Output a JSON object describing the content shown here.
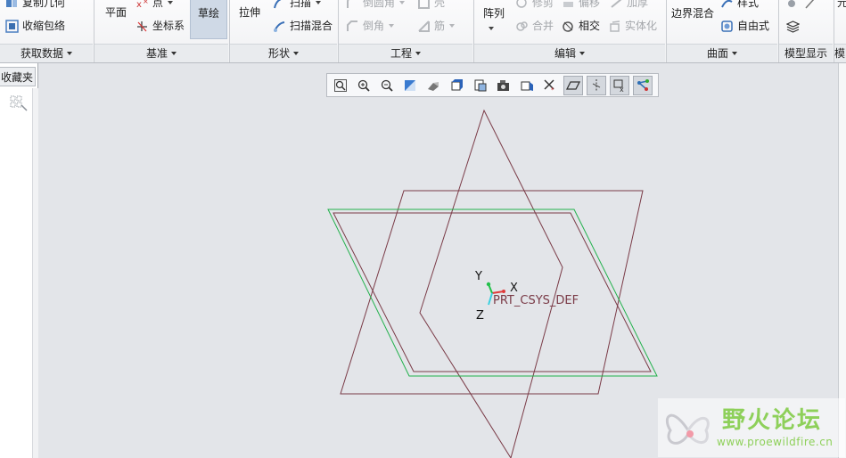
{
  "ribbon": {
    "groups": {
      "get_data": {
        "label": "获取数据",
        "items": {
          "copy_geometry": "复制几何",
          "shrinkwrap": "收缩包络"
        }
      },
      "datum": {
        "label": "基准",
        "items": {
          "plane": "平面",
          "point": "点",
          "csys": "坐标系",
          "sketch": "草绘"
        }
      },
      "shapes": {
        "label": "形状",
        "items": {
          "extrude": "拉伸",
          "sweep": "扫描",
          "swept_blend": "扫描混合"
        }
      },
      "engineering": {
        "label": "工程",
        "items": {
          "round": "倒圆角",
          "shell": "壳",
          "chamfer": "倒角",
          "rib": "筋"
        }
      },
      "editing": {
        "label": "编辑",
        "items": {
          "pattern": "阵列",
          "trim": "修剪",
          "offset": "偏移",
          "thicken": "加厚",
          "merge": "合并",
          "intersect": "相交",
          "solidify": "实体化"
        }
      },
      "surfaces": {
        "label": "曲面",
        "items": {
          "boundary_blend": "边界混合",
          "style": "样式",
          "freestyle": "自由式"
        }
      },
      "model_display": {
        "label": "模型显示"
      },
      "cut_right": {
        "label": "模",
        "item": "元"
      }
    }
  },
  "left_panel": {
    "tab_label": "收藏夹"
  },
  "view_toolbar": {
    "buttons": [
      "refit-icon",
      "zoom-in-icon",
      "zoom-out-icon",
      "repaint-icon",
      "display-style-icon",
      "saved-orientations-icon",
      "named-views-icon",
      "view-manager-icon",
      "perspective-icon",
      "annotation-display-icon",
      "plane-display-icon",
      "axis-display-icon",
      "point-display-icon",
      "csys-display-icon"
    ],
    "active": [
      10,
      11,
      12,
      13
    ]
  },
  "canvas": {
    "csys_name": "PRT_CSYS_DEF",
    "axis_x": "X",
    "axis_y": "Y",
    "axis_z": "Z",
    "colors": {
      "datum_plane": "#7a3b47",
      "selected_plane": "#22b14c",
      "x_axis": "#e03a3a",
      "y_axis": "#22c04a",
      "z_axis": "#3ad0e0",
      "background": "#e3e5e9"
    }
  },
  "watermark": {
    "title": "野火论坛",
    "url": "www.proewildfire.cn"
  }
}
